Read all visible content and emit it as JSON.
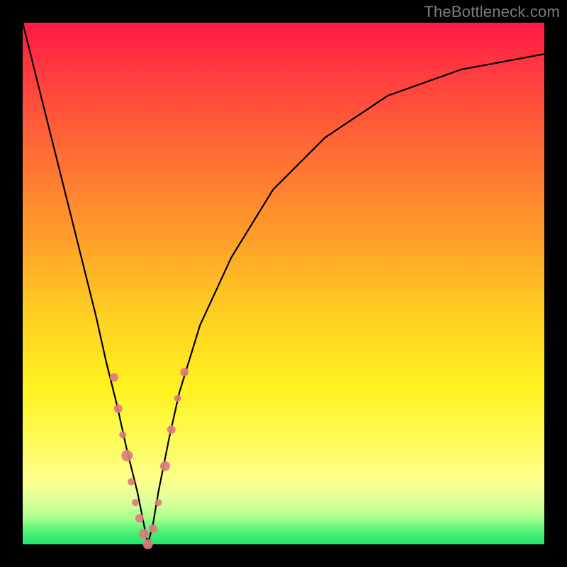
{
  "watermark": "TheBottleneck.com",
  "colors": {
    "frame": "#000000",
    "gradient_top": "#ff1a44",
    "gradient_bottom": "#1de46c",
    "curve": "#000000",
    "markers": "#e07a7f"
  },
  "chart_data": {
    "type": "line",
    "title": "",
    "xlabel": "",
    "ylabel": "",
    "xlim": [
      0,
      100
    ],
    "ylim": [
      0,
      100
    ],
    "notch_x": 24,
    "series": [
      {
        "name": "curve",
        "x": [
          0,
          4,
          8,
          12,
          14,
          16,
          18,
          20,
          22,
          23,
          24,
          25,
          26,
          28,
          30,
          34,
          40,
          48,
          58,
          70,
          84,
          100
        ],
        "values": [
          100,
          84,
          68,
          52,
          44,
          35,
          27,
          18,
          10,
          5,
          0,
          4,
          10,
          20,
          29,
          42,
          55,
          68,
          78,
          86,
          91,
          94
        ]
      }
    ],
    "markers": [
      {
        "x": 17.5,
        "y": 32,
        "r": 6
      },
      {
        "x": 18.3,
        "y": 26,
        "r": 6
      },
      {
        "x": 19.2,
        "y": 21,
        "r": 5
      },
      {
        "x": 20.0,
        "y": 17,
        "r": 8
      },
      {
        "x": 20.8,
        "y": 12,
        "r": 5
      },
      {
        "x": 21.6,
        "y": 8,
        "r": 5
      },
      {
        "x": 22.4,
        "y": 5,
        "r": 6
      },
      {
        "x": 23.2,
        "y": 2,
        "r": 7
      },
      {
        "x": 24.0,
        "y": 0,
        "r": 7
      },
      {
        "x": 25.0,
        "y": 3,
        "r": 6
      },
      {
        "x": 26.0,
        "y": 8,
        "r": 5
      },
      {
        "x": 27.3,
        "y": 15,
        "r": 7
      },
      {
        "x": 28.5,
        "y": 22,
        "r": 6
      },
      {
        "x": 29.7,
        "y": 28,
        "r": 5
      },
      {
        "x": 31.0,
        "y": 33,
        "r": 6
      }
    ]
  }
}
